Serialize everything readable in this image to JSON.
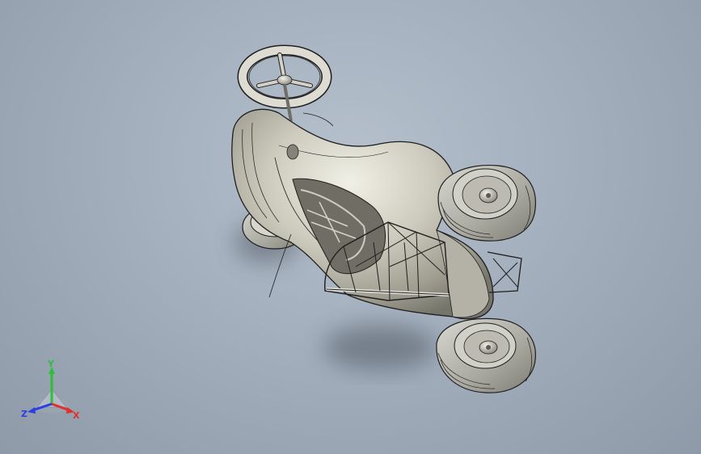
{
  "viewport": {
    "background_top": "#b5c0cc",
    "background_bottom": "#8f9aa9"
  },
  "model": {
    "body_color": "#c9c7ba",
    "frame_color": "#d6d6cf",
    "tire_color": "#9a9a92",
    "edge_color": "#1e1e1e"
  },
  "triad": {
    "x_label": "X",
    "y_label": "Y",
    "z_label": "Z",
    "x_color": "#e0302a",
    "y_color": "#2bbf3a",
    "z_color": "#2a3fe0"
  }
}
